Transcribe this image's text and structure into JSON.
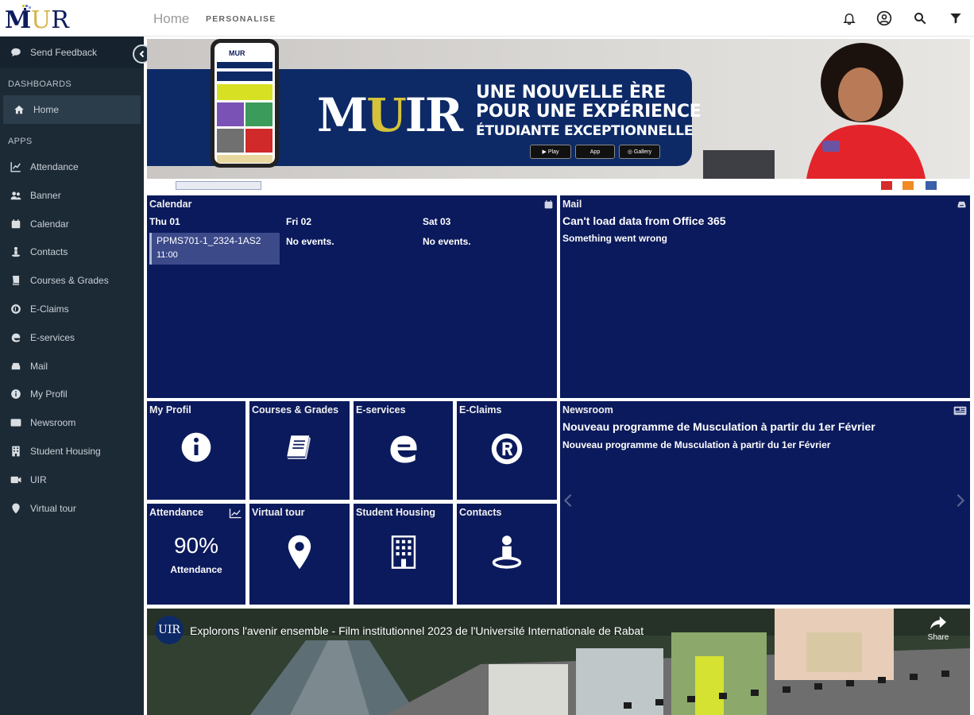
{
  "topbar": {
    "logo_text": "MUR",
    "nav_home": "Home",
    "nav_personalise": "PERSONALISE"
  },
  "sidebar": {
    "feedback": "Send Feedback",
    "dashboards_heading": "DASHBOARDS",
    "home": "Home",
    "apps_heading": "APPS",
    "items": [
      {
        "label": "Attendance",
        "icon": "chart-line-icon"
      },
      {
        "label": "Banner",
        "icon": "users-icon"
      },
      {
        "label": "Calendar",
        "icon": "calendar-icon"
      },
      {
        "label": "Contacts",
        "icon": "contact-icon"
      },
      {
        "label": "Courses & Grades",
        "icon": "book-icon"
      },
      {
        "label": "E-Claims",
        "icon": "registered-icon"
      },
      {
        "label": "E-services",
        "icon": "edge-icon"
      },
      {
        "label": "Mail",
        "icon": "mail-icon"
      },
      {
        "label": "My Profil",
        "icon": "info-icon"
      },
      {
        "label": "Newsroom",
        "icon": "newspaper-icon"
      },
      {
        "label": "Student Housing",
        "icon": "building-icon"
      },
      {
        "label": "UIR",
        "icon": "video-icon"
      },
      {
        "label": "Virtual tour",
        "icon": "map-marker-icon"
      }
    ]
  },
  "banner": {
    "tagline_1": "UNE NOUVELLE ÈRE",
    "tagline_2": "POUR UNE EXPÉRIENCE",
    "tagline_3": "ÉTUDIANTE EXCEPTIONNELLE",
    "logo": "MUIR"
  },
  "calendar": {
    "title": "Calendar",
    "days": [
      {
        "label": "Thu 01",
        "event_title": "PPMS701-1_2324-1AS2",
        "event_time": "11:00"
      },
      {
        "label": "Fri 02",
        "empty": "No events."
      },
      {
        "label": "Sat 03",
        "empty": "No events."
      }
    ]
  },
  "mail": {
    "title": "Mail",
    "error_title": "Can't load data from Office 365",
    "error_detail": "Something went wrong"
  },
  "tiles": {
    "my_profil": "My Profil",
    "courses": "Courses & Grades",
    "eservices": "E-services",
    "eclaims": "E-Claims",
    "attendance": "Attendance",
    "attendance_value": "90%",
    "attendance_caption": "Attendance",
    "virtual_tour": "Virtual tour",
    "student_housing": "Student Housing",
    "contacts": "Contacts"
  },
  "newsroom": {
    "title": "Newsroom",
    "headline": "Nouveau programme de Musculation à partir du 1er Février",
    "subline": "Nouveau programme de Musculation à partir du 1er Février"
  },
  "video": {
    "title": "Explorons l'avenir ensemble - Film institutionnel 2023 de l'Université Internationale de Rabat",
    "channel_logo": "UIR",
    "share": "Share"
  },
  "colors": {
    "tile_bg": "#0b1a5c",
    "sidebar_bg": "#1c2a36",
    "brand_gold": "#d4c33a"
  }
}
